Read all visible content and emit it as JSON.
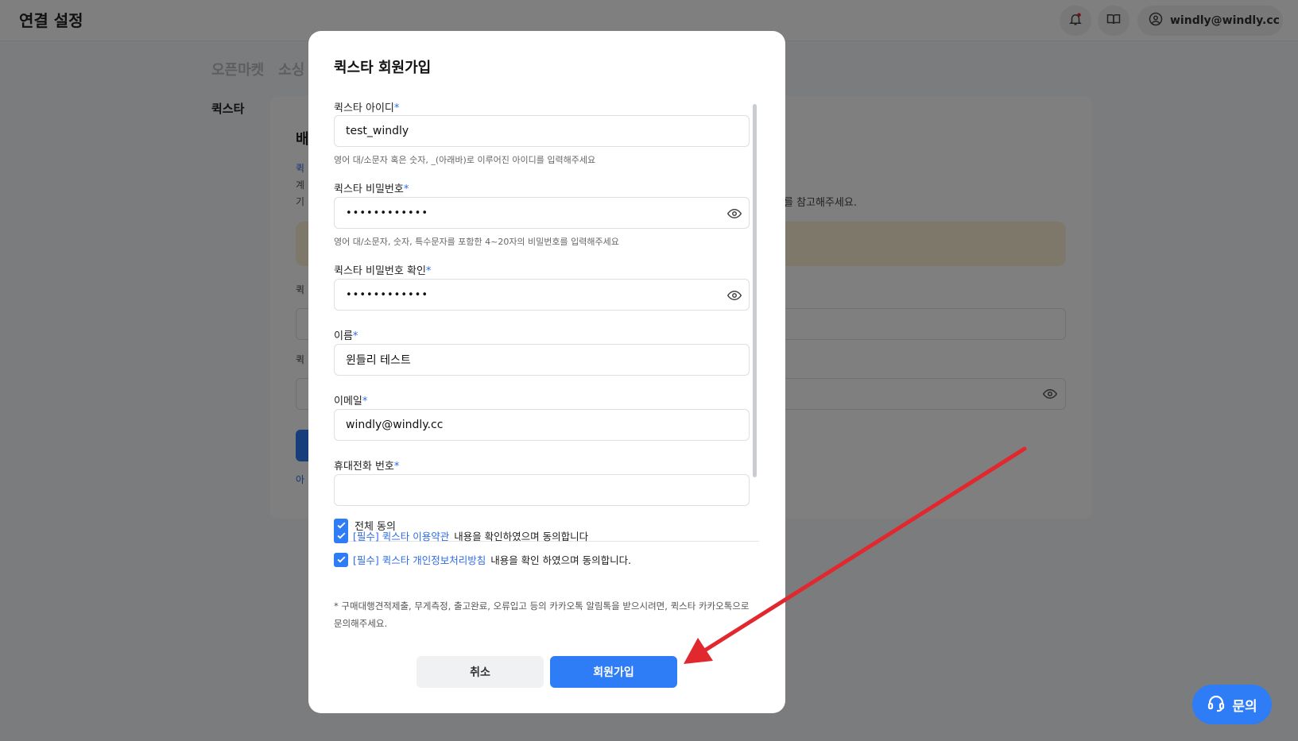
{
  "header": {
    "title": "연결 설정",
    "user_email": "windly@windly.cc",
    "icons": [
      "bell-icon",
      "book-icon",
      "user-circle-icon"
    ]
  },
  "background": {
    "tabs": [
      "오픈마켓",
      "소싱"
    ],
    "side_label": "퀵스타",
    "card_title": "배",
    "card_link_fragment": "퀵",
    "card_line_2": "계",
    "card_line_3": "기",
    "guide_reference": "를 참고해주세요.",
    "field_label_1": "퀵",
    "field_label_2": "퀵",
    "link_fragment": "아"
  },
  "modal": {
    "title": "퀵스타 회원가입",
    "fields": {
      "id": {
        "label": "퀵스타 아이디",
        "required": "*",
        "value": "test_windly",
        "hint": "영어 대/소문자 혹은 숫자, _(아래바)로 이루어진 아이디를 입력해주세요"
      },
      "password": {
        "label": "퀵스타 비밀번호",
        "required": "*",
        "value": "••••••••••••",
        "hint": "영어 대/소문자, 숫자, 특수문자를 포함한 4~20자의 비밀번호를 입력해주세요"
      },
      "password_confirm": {
        "label": "퀵스타 비밀번호 확인",
        "required": "*",
        "value": "••••••••••••"
      },
      "name": {
        "label": "이름",
        "required": "*",
        "value": "윈들리 테스트"
      },
      "email": {
        "label": "이메일",
        "required": "*",
        "value": "windly@windly.cc"
      },
      "phone": {
        "label": "휴대전화 번호",
        "required": "*",
        "value": ""
      }
    },
    "agree_all": "전체 동의",
    "agreements": [
      {
        "link": "[필수] 퀵스타 이용약관",
        "text": "내용을 확인하였으며 동의합니다",
        "checked": true
      },
      {
        "link": "[필수] 퀵스타 개인정보처리방침",
        "text": "내용을 확인 하였으며 동의합니다.",
        "checked": true
      }
    ],
    "footnote": "* 구매대행견적제출, 무게측정, 출고완료, 오류입고 등의 카카오톡 알림톡을 받으시려면, 퀵스타 카카오톡으로 문의해주세요.",
    "cancel_label": "취소",
    "signup_label": "회원가입"
  },
  "inquiry": {
    "label": "문의"
  },
  "colors": {
    "accent": "#2e7cf6",
    "link": "#2e6be6",
    "arrow": "#e0282e",
    "notice": "#fdf1d4"
  }
}
